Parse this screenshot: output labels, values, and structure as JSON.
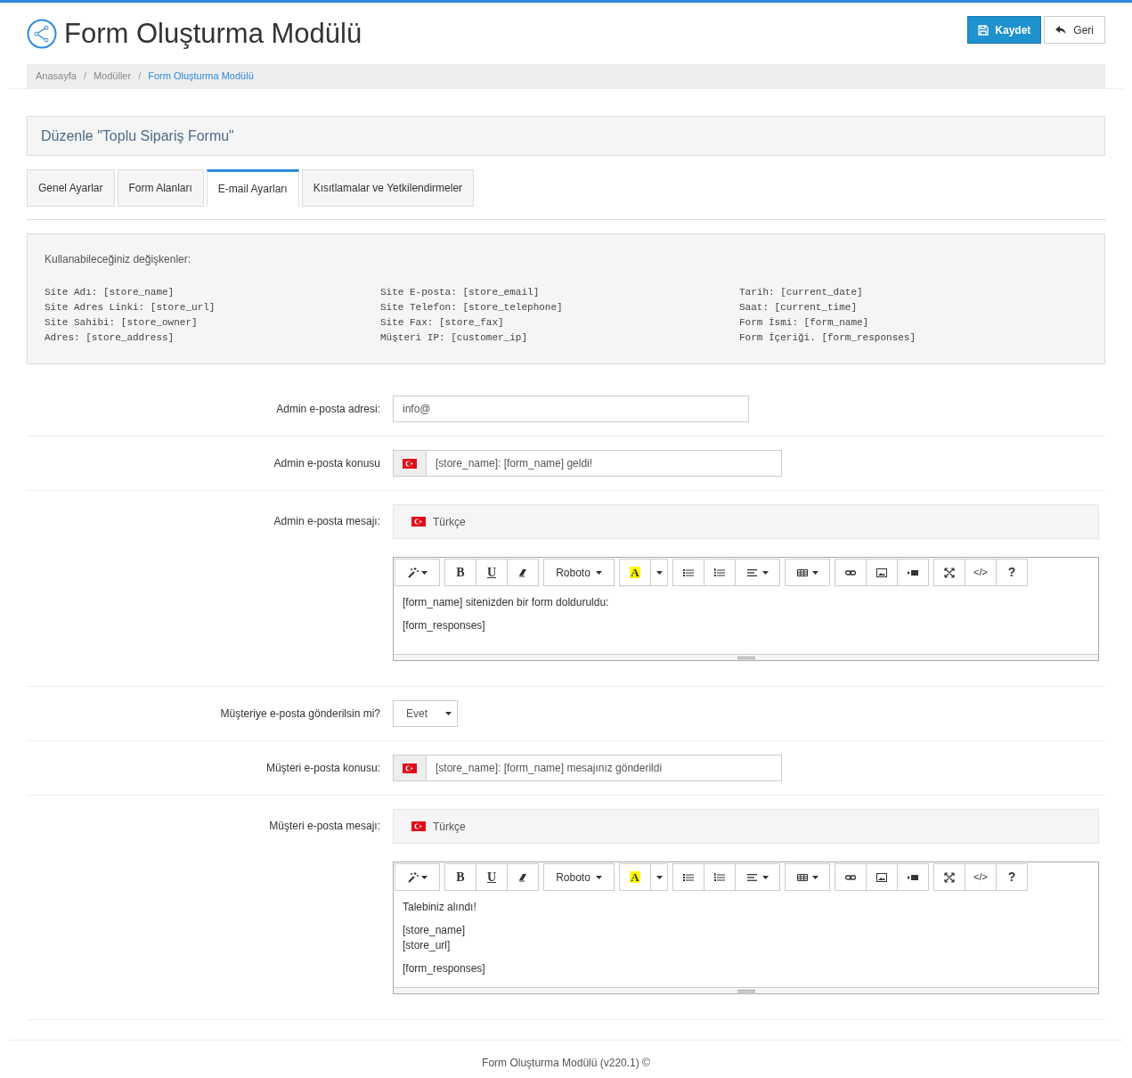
{
  "header": {
    "title": "Form Oluşturma Modülü",
    "buttons": [
      {
        "kind": "primary",
        "label": "Kaydet"
      },
      {
        "kind": "default",
        "label": "Geri"
      }
    ]
  },
  "breadcrumb": [
    {
      "label": "Anasayfa",
      "selected": false
    },
    {
      "separator": "/",
      "label": "Modüller",
      "selected": false
    },
    {
      "separator": "/",
      "label": "Form Oluşturma Modülü",
      "selected": true
    }
  ],
  "panel_title": "Düzenle \"Toplu Sipariş Formu\"",
  "tabs": [
    {
      "label": "Genel Ayarlar",
      "selected": false
    },
    {
      "label": "Form Alanları",
      "selected": false
    },
    {
      "label": "E-mail Ayarları",
      "selected": true
    },
    {
      "label": "Kısıtlamalar ve Yetkilendirmeler",
      "selected": false
    }
  ],
  "variables": {
    "title": "Kullanabileceğiniz değişkenler:",
    "columns": [
      [
        "Site Adı: [store_name]",
        "Site Adres Linki: [store_url]",
        "Site Sahibi: [store_owner]",
        "Adres: [store_address]"
      ],
      [
        "Site E-posta: [store_email]",
        "Site Telefon: [store_telephone]",
        "Site Fax: [store_fax]",
        "Müşteri IP: [customer_ip]"
      ],
      [
        "Tarih: [current_date]",
        "Saat: [current_time]",
        "Form İsmi: [form_name]",
        "Form İçeriği. [form_responses]"
      ]
    ]
  },
  "fields": [
    {
      "kind": "input",
      "label": "Admin e-posta adresi:",
      "value": "info@"
    },
    {
      "kind": "flag_input",
      "label": "Admin e-posta konusu",
      "value": "[store_name]: [form_name] geldi!"
    },
    {
      "kind": "editor",
      "label": "Admin e-posta mesajı:",
      "language": "Türkçe",
      "toolbar": [
        {
          "kind": "magic"
        },
        {
          "kind": "bold",
          "label": "B"
        },
        {
          "kind": "underline",
          "label": "U"
        },
        {
          "kind": "eraser"
        },
        {
          "kind": "font",
          "label": "Roboto"
        },
        {
          "kind": "color",
          "label": "A"
        },
        {
          "kind": "caret"
        },
        {
          "kind": "ul"
        },
        {
          "kind": "ol"
        },
        {
          "kind": "align"
        },
        {
          "kind": "table"
        },
        {
          "kind": "link"
        },
        {
          "kind": "image"
        },
        {
          "kind": "video"
        },
        {
          "kind": "fullscreen"
        },
        {
          "kind": "code",
          "label": "</>"
        },
        {
          "kind": "help",
          "label": "?"
        }
      ],
      "paragraphs": [
        [
          "[form_name] sitenizden bir form dolduruldu:"
        ],
        [
          "[form_responses]"
        ]
      ]
    },
    {
      "kind": "select",
      "label": "Müşteriye e-posta gönderilsin mi?",
      "value": "Evet"
    },
    {
      "kind": "flag_input",
      "label": "Müşteri e-posta konusu:",
      "value": "[store_name]: [form_name] mesajınız gönderildi"
    },
    {
      "kind": "editor",
      "label": "Müşteri e-posta mesajı:",
      "language": "Türkçe",
      "toolbar": [
        {
          "kind": "magic"
        },
        {
          "kind": "bold",
          "label": "B"
        },
        {
          "kind": "underline",
          "label": "U"
        },
        {
          "kind": "eraser"
        },
        {
          "kind": "font",
          "label": "Roboto"
        },
        {
          "kind": "color",
          "label": "A"
        },
        {
          "kind": "caret"
        },
        {
          "kind": "ul"
        },
        {
          "kind": "ol"
        },
        {
          "kind": "align"
        },
        {
          "kind": "table"
        },
        {
          "kind": "link"
        },
        {
          "kind": "image"
        },
        {
          "kind": "video"
        },
        {
          "kind": "fullscreen"
        },
        {
          "kind": "code",
          "label": "</>"
        },
        {
          "kind": "help",
          "label": "?"
        }
      ],
      "paragraphs": [
        [
          "Talebiniz alındı!"
        ],
        [
          "[store_name]",
          "[store_url]"
        ],
        [
          "[form_responses]"
        ]
      ]
    }
  ],
  "footer": "Form Oluşturma Modülü (v220.1) ©"
}
